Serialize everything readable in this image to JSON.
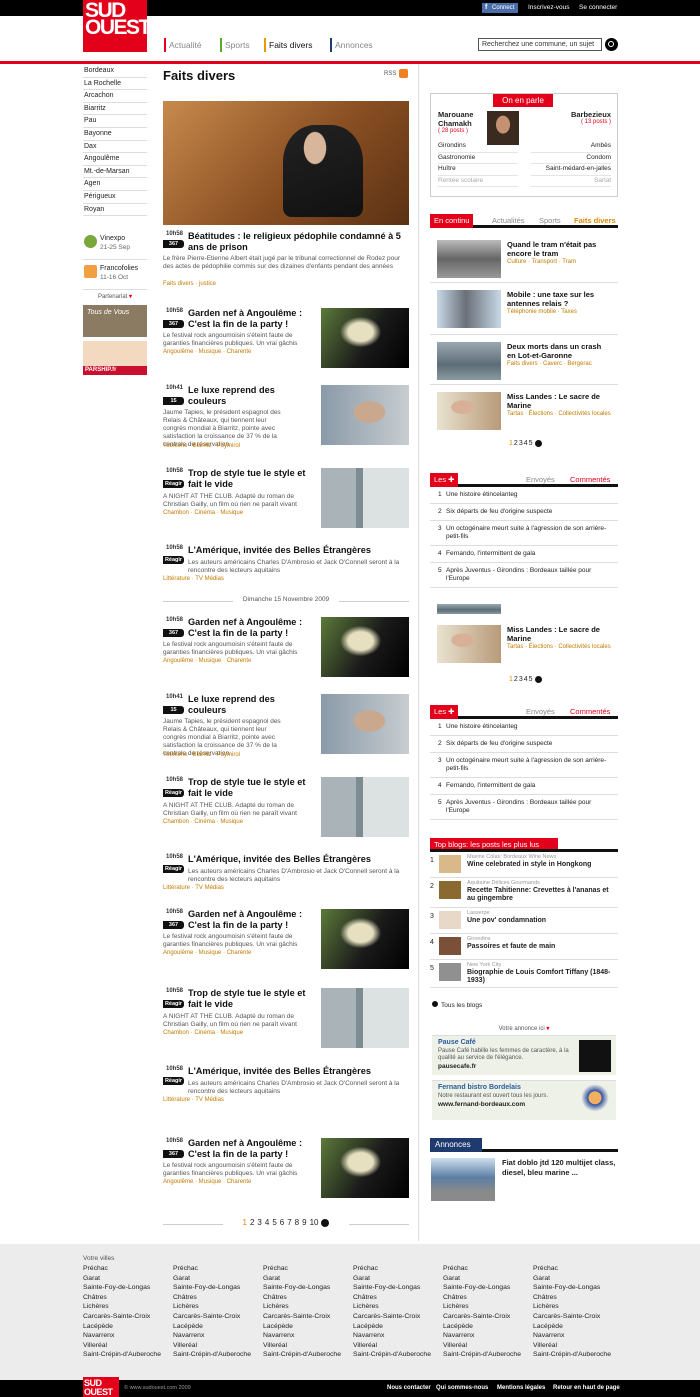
{
  "topbar": {
    "facebook": "Connect",
    "signup": "Inscrivez-vous",
    "login": "Se connecter"
  },
  "logo": {
    "line1": "SUD",
    "line2": "OUEST"
  },
  "nav": [
    {
      "label": "Actualité",
      "color": "#e2001a"
    },
    {
      "label": "Sports",
      "color": "#5aab2a"
    },
    {
      "label": "Faits divers",
      "color": "#e69a00"
    },
    {
      "label": "Annonces",
      "color": "#1f3a6e"
    }
  ],
  "search": {
    "placeholder": "Recherchez une commune, un sujet"
  },
  "cities": [
    "Bordeaux",
    "La Rochelle",
    "Arcachon",
    "Biarritz",
    "Pau",
    "Bayonne",
    "Dax",
    "Angoulême",
    "Mt.-de-Marsan",
    "Agen",
    "Périgueux",
    "Royan"
  ],
  "events": [
    {
      "title": "Vinexpo",
      "dates": "21-25 Sep"
    },
    {
      "title": "Francofolies",
      "dates": "11-16 Oct"
    }
  ],
  "partner": {
    "label": "Partenariat",
    "ad1": "Tous de Vous",
    "ad2": "PARSHIP.fr"
  },
  "main": {
    "title": "Faits divers",
    "rss": "RSS",
    "date_sep": "Dimanche 15 Novembre 2009",
    "pages": [
      "1",
      "2",
      "3",
      "4",
      "5",
      "6",
      "7",
      "8",
      "9",
      "10"
    ]
  },
  "articles": [
    {
      "time": "10h58",
      "badge": "367",
      "title": "Béatitudes : le religieux pédophile condamné à 5 ans de prison",
      "summary": "Le frère Pierre-Etienne Albert était jugé par le tribunal correctionnel de Rodez pour des actes de pédophilie commis sur des dizaines d'enfants pendant des années",
      "tags": "Faits divers · justice"
    },
    {
      "time": "10h58",
      "badge": "367",
      "title": "Garden nef à Angoulême : C'est la fin de la party !",
      "summary": "Le festival rock angoumoisin s'éteint faute de garanties financières publiques. Un vrai gâchis",
      "tags": "Angoulême · Musique · Charente"
    },
    {
      "time": "10h41",
      "badge": "15",
      "title": "Le luxe reprend des couleurs",
      "summary": "Jaume Tapies, le président espagnol des Relais & Châteaux, qui tiennent leur congrès mondial à Biarritz, pointe avec satisfaction la croissance de 37 % de la centrale de réservation.",
      "tags": "Tourisme · Biarritz · Puymirol"
    },
    {
      "time": "10h58",
      "badge": "Réagir",
      "title": "Trop de style tue le style et fait le vide",
      "summary": "A NIGHT AT THE CLUB. Adapté du roman de Christian Gailly, un film où rien ne paraît vivant",
      "tags": "Chambon · Cinéma · Musique"
    },
    {
      "time": "10h58",
      "badge": "Réagir",
      "title": "L'Amérique, invitée des Belles Étrangères",
      "summary": "Les auteurs américains Charles D'Ambrosio et Jack O'Connell seront à la rencontre des lecteurs aquitains",
      "tags": "Littérature · TV Médias"
    }
  ],
  "onparle": {
    "label": "On en parle",
    "left": {
      "name": "Marouane Chamakh",
      "count": "( 28 posts )",
      "items": [
        "Girondins",
        "Gastronomie",
        "Huître",
        "Rentée scolaire"
      ]
    },
    "right": {
      "name": "Barbezieux",
      "count": "( 13 posts )",
      "items": [
        "Ambès",
        "Condom",
        "Saint-médard-en-jalles",
        "Sarlat"
      ]
    }
  },
  "encontinu": {
    "label": "En continu",
    "tabs": [
      "Actualités",
      "Sports",
      "Faits divers"
    ],
    "items": [
      {
        "title": "Quand le tram n'était pas encore le tram",
        "tags": "Culture · Transport · Tram"
      },
      {
        "title": "Mobile : une taxe sur les antennes relais ?",
        "tags": "Téléphonie mobile · Taxes"
      },
      {
        "title": "Deux morts dans un crash en Lot-et-Garonne",
        "tags": "Faits divers · Caverc · Bergerac"
      },
      {
        "title": "Miss Landes : Le sacre de Marine",
        "tags": "Tartas · Élections · Collectivités locales"
      }
    ],
    "pages": [
      "1",
      "2",
      "3",
      "4",
      "5"
    ]
  },
  "lesplus": {
    "label": "Les",
    "tabs": [
      "Envoyés",
      "Commentés"
    ],
    "items": [
      "Une histoire étincelanteg",
      "Six départs de feu d'origine suspecte",
      "Un octogénaire meurt suite à l'agression de son arrière-petit-fils",
      "Fernando, l'intermittent de gala",
      "Après Juventus - Girondins : Bordeaux taillée pour l'Europe"
    ]
  },
  "topblogs": {
    "label": "Top blogs: les posts les plus lus",
    "items": [
      {
        "n": "1",
        "source": "Maxine Colas: Bordeaux Wine News",
        "title": "Wine celebrated in style in Hongkong"
      },
      {
        "n": "2",
        "source": "Aquitaine Délices Gourmands",
        "title": "Recette Tahitienne: Crevettes à l'ananas et au gingembre"
      },
      {
        "n": "3",
        "source": "Lasserpe",
        "title": "Une pov' condamnation"
      },
      {
        "n": "4",
        "source": "Girondins",
        "title": "Passoires et faute de main"
      },
      {
        "n": "5",
        "source": "New York City",
        "title": "Biographie de Louis Comfort Tiffany (1848-1933)"
      }
    ],
    "all": "Tous les blogs"
  },
  "ads": {
    "here": "Votre annonce ici",
    "items": [
      {
        "title": "Pause Café",
        "desc": "Pause Café habille les femmes de caractère, à la qualité au service de l'élégance.",
        "url": "pausecafe.fr"
      },
      {
        "title": "Fernand bistro Bordelais",
        "desc": "Notre restaurant est ouvert tous les jours.",
        "url": "www.fernand-bordeaux.com"
      }
    ]
  },
  "annonces": {
    "label": "Annonces",
    "title": "Fiat doblo jtd 120 multijet class, diesel, bleu marine ..."
  },
  "footer": {
    "villes_label": "Votre villes",
    "villes": [
      "Préchac",
      "Garat",
      "Sainte-Foy-de-Longas",
      "Châtres",
      "Lichères",
      "Carcarès-Sainte-Croix",
      "Lacépède",
      "Navarrenx",
      "Villeréal",
      "Saint-Crépin-d'Auberoche"
    ],
    "copyright": "© www.sudouest.com 2009",
    "links": [
      "Nous contacter",
      "Qui sommes-nous",
      "Mentions légales",
      "Retour en haut de page"
    ]
  }
}
